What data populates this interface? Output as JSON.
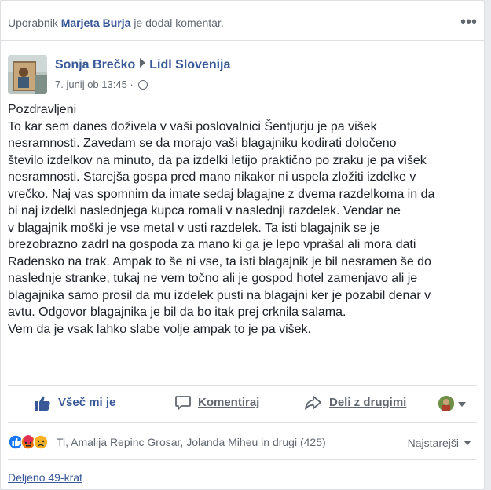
{
  "notification": {
    "prefix": "Uporabnik",
    "user": "Marjeta Burja",
    "suffix": "je dodal komentar."
  },
  "post": {
    "author": "Sonja Brečko",
    "page": "Lidl Slovenija",
    "date": "7. junij ob 13:45",
    "separator": "·",
    "lines": [
      "Pozdravljeni",
      "To kar sem danes doživela v vaši poslovalnici Šentjurju je pa višek",
      "nesramnosti. Zavedam se da morajo vaši blagajniku kodirati določeno",
      "število izdelkov na minuto, da pa izdelki letijo praktično po zraku je pa višek",
      "nesramnosti. Starejša gospa pred mano nikakor ni uspela zložiti izdelke v",
      "vrečko. Naj vas spomnim da imate sedaj blagajne z dvema razdelkoma in da",
      "bi naj izdelki naslednjega kupca romali v naslednji razdelek. Vendar ne",
      "v blagajnik moški je vse metal v usti razdelek. Ta isti blagajnik se je",
      "brezobrazno zadrl na gospoda za mano ki ga je lepo vprašal ali mora dati",
      "Radensko na trak. Ampak to še ni vse, ta isti blagajnik je bil nesramen še do",
      "naslednje stranke, tukaj ne vem točno ali je gospod hotel zamenjavo ali je",
      "blagajnika samo prosil da mu izdelek pusti na blagajni ker je pozabil denar v",
      "avtu. Odgovor blagajnika je bil da bo itak prej crknila salama.",
      "Vem da je vsak lahko slabe volje ampak to je pa višek."
    ]
  },
  "actions": {
    "like": "Všeč mi je",
    "comment": "Komentiraj",
    "share": "Deli z drugimi"
  },
  "reactions": {
    "summary": "Ti, Amalija Repinc Grosar, Jolanda Miheu in drugi (425)",
    "icons": [
      "like-icon",
      "angry-icon",
      "sad-icon"
    ]
  },
  "sort": {
    "label": "Najstarejši"
  },
  "shares": {
    "label": "Deljeno 49-krat"
  },
  "colors": {
    "link": "#385898",
    "muted": "#606770",
    "text": "#1d2129",
    "like_blue": "#1877f2"
  }
}
